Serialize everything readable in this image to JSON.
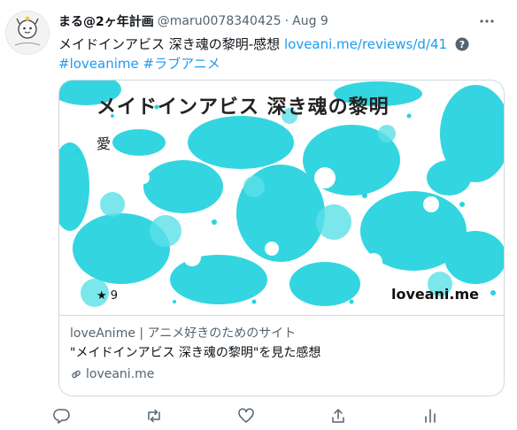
{
  "tweet": {
    "avatar_icon": "avatar-icon",
    "display_name": "まる@2ヶ年計画",
    "handle": "@maru0078340425",
    "separator": "·",
    "date": "Aug 9",
    "text_main": "メイドインアビス 深き魂の黎明-感想",
    "link": "loveani.me/reviews/d/41",
    "hashtags": [
      "#loveanime",
      "#ラブアニメ"
    ]
  },
  "card": {
    "image_title": "メイドインアビス 深き魂の黎明",
    "image_subtitle": "愛",
    "image_rating": "★ 9",
    "image_site": "loveani.me",
    "site_name": "loveAnime | アニメ好きのためのサイト",
    "title": "\"メイドインアビス 深き魂の黎明\"を見た感想",
    "domain": "loveani.me",
    "splash_color": "#29d3df"
  },
  "icons": [
    "more-icon",
    "question-icon",
    "link-icon",
    "reply-icon",
    "retweet-icon",
    "like-icon",
    "share-icon",
    "analytics-icon"
  ]
}
